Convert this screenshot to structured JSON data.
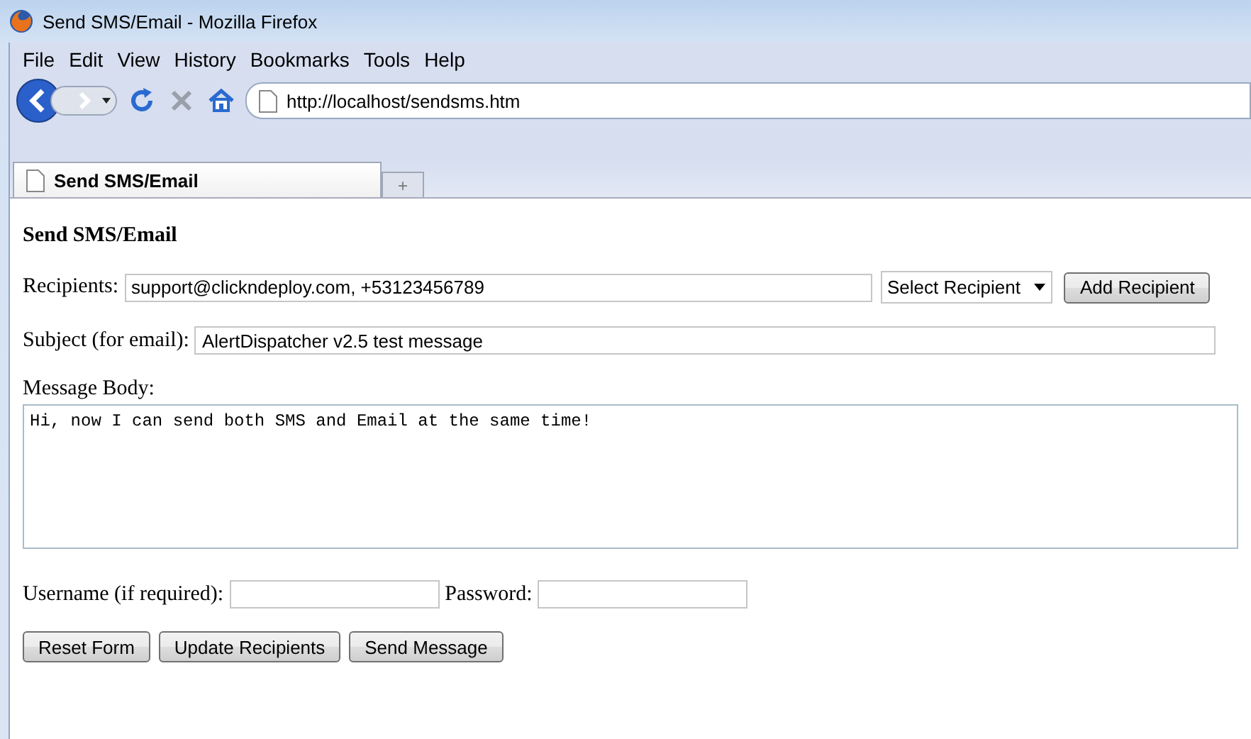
{
  "window": {
    "title": "Send SMS/Email - Mozilla Firefox"
  },
  "menu": [
    "File",
    "Edit",
    "View",
    "History",
    "Bookmarks",
    "Tools",
    "Help"
  ],
  "address_bar": {
    "value": "http://localhost/sendsms.htm"
  },
  "tabs": [
    {
      "label": "Send SMS/Email",
      "selected": true
    }
  ],
  "new_tab": "+",
  "page": {
    "heading": "Send SMS/Email",
    "recipients": {
      "label": "Recipients:",
      "value": "support@clickndeploy.com, +53123456789",
      "select": "Select Recipient",
      "button": "Add Recipient"
    },
    "subject": {
      "label": "Subject (for email):",
      "value": "AlertDispatcher v2.5 test message"
    },
    "body": {
      "label": "Message Body:",
      "value": "Hi, now I can send both SMS and Email at the same time!"
    },
    "username": {
      "label": "Username (if required):"
    },
    "password": {
      "label": "Password:"
    },
    "buttons": [
      "Reset Form",
      "Update Recipients",
      "Send Message"
    ]
  }
}
